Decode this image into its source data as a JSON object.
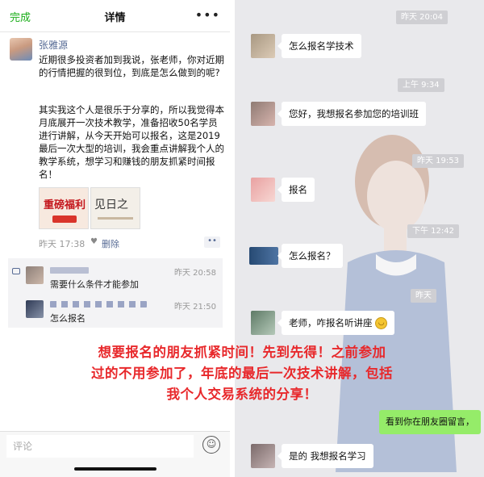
{
  "moments": {
    "header": {
      "done_label": "完成",
      "title": "详情",
      "more_icon": "more-icon"
    },
    "author": "张雅源",
    "post_paragraph_1": "近期很多投资者加到我说，张老师，你对近期的行情把握的很到位，到底是怎么做到的呢?",
    "post_paragraph_2": "其实我这个人是很乐于分享的，所以我觉得本月底展开一次技术教学，准备招收50名学员进行讲解，从今天开始可以报名，这是2019最后一次大型的培训，我会重点讲解我个人的教学系统，想学习和赚钱的朋友抓紧时间报名！",
    "thumb1_text": "重磅福利",
    "thumb2_text": "见日之",
    "time": "昨天 17:38",
    "delete_label": "删除",
    "comments": [
      {
        "time": "昨天 20:58",
        "text": "需要什么条件才能参加"
      },
      {
        "time": "昨天 21:50",
        "text": "怎么报名"
      }
    ],
    "comment_placeholder": "评论"
  },
  "chat": {
    "messages": [
      {
        "timestamp": "昨天 20:04",
        "text": "怎么报名学技术"
      },
      {
        "timestamp": "上午 9:34",
        "text": "您好，我想报名参加您的培训班"
      },
      {
        "timestamp": "昨天 19:53",
        "text": "报名"
      },
      {
        "timestamp": "下午 12:42",
        "text": "怎么报名？"
      },
      {
        "timestamp": "昨天",
        "text": "老师，咋报名听讲座"
      },
      {
        "timestamp": "",
        "text": "看到你在朋友圈留言，"
      },
      {
        "timestamp": "",
        "text": "是的 我想报名学习"
      }
    ]
  },
  "overlay_lines": [
    "想要报名的朋友抓紧时间！先到先得！之前参加",
    "过的不用参加了，年底的最后一次技术讲解，包括",
    "我个人交易系统的分享！"
  ],
  "colors": {
    "wechat_green": "#1aad19",
    "link_blue": "#576b95",
    "caption_red": "#e8282b",
    "bubble_green": "#95ec69"
  }
}
